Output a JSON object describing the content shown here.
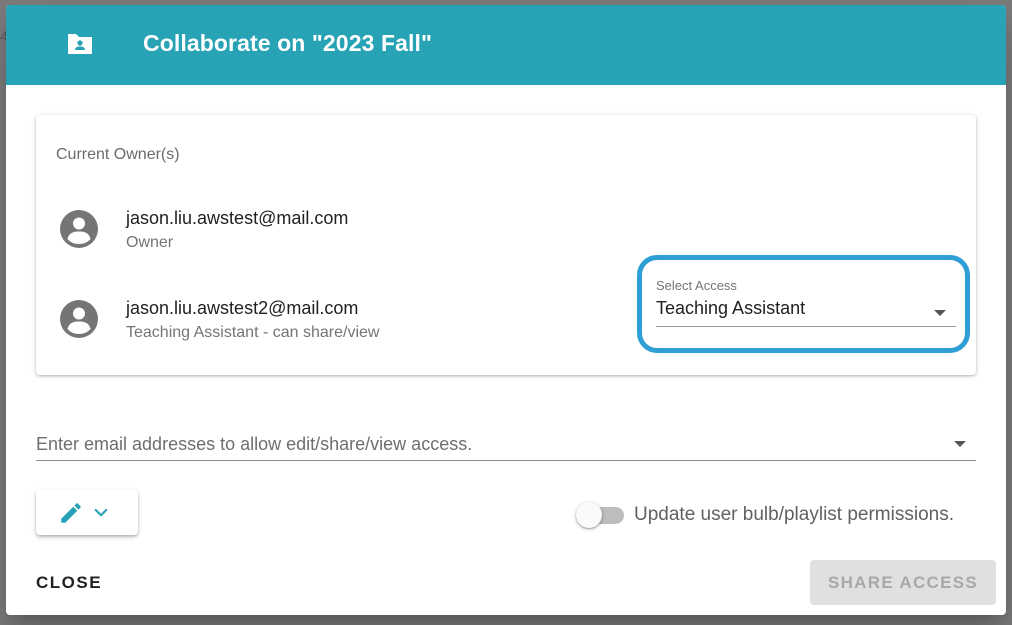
{
  "dialog": {
    "title": "Collaborate on \"2023 Fall\"",
    "header_icon": "shared-folder-icon",
    "header_color": "#27a3b5"
  },
  "owners": {
    "label": "Current Owner(s)",
    "users": [
      {
        "email": "jason.liu.awstest@mail.com",
        "role": "Owner",
        "icon": "account-circle-icon"
      },
      {
        "email": "jason.liu.awstest2@mail.com",
        "role": "Teaching Assistant - can share/view",
        "icon": "account-circle-icon"
      }
    ]
  },
  "access_select": {
    "label": "Select Access",
    "value": "Teaching Assistant",
    "highlight_color": "#2e9ed6"
  },
  "email_input": {
    "placeholder": "Enter email addresses to allow edit/share/view access.",
    "value": ""
  },
  "permission_button": {
    "icon": "pencil-icon",
    "menu_icon": "chevron-down-icon",
    "icon_color": "#27a3b5"
  },
  "toggle": {
    "label": "Update user bulb/playlist permissions.",
    "checked": false
  },
  "actions": {
    "close_label": "CLOSE",
    "share_label": "SHARE ACCESS",
    "share_disabled": true
  }
}
